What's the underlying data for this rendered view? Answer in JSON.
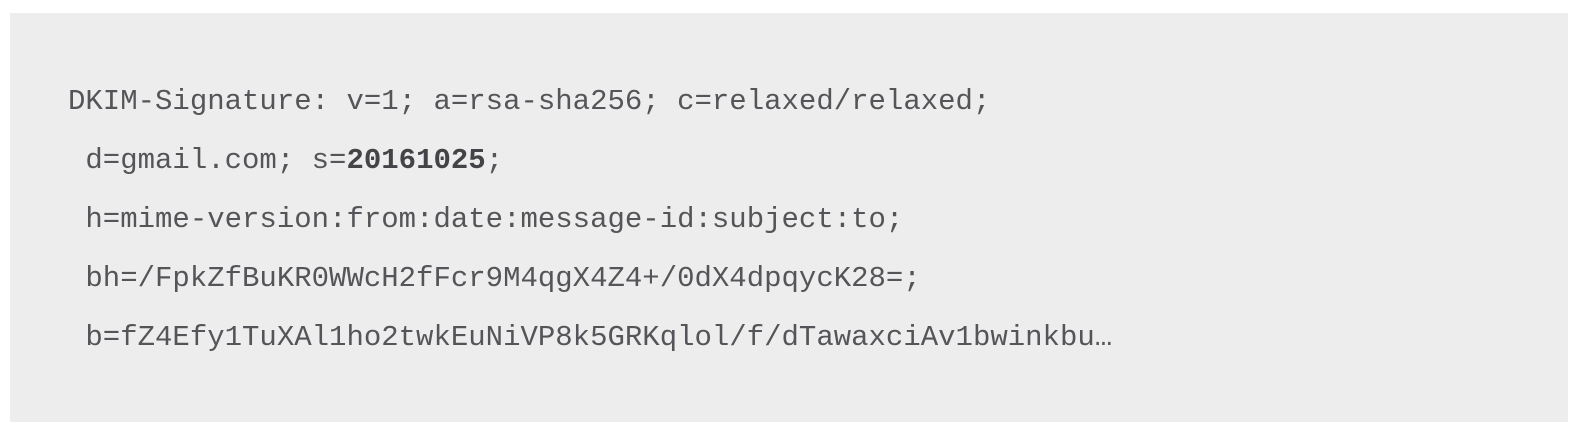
{
  "dkim": {
    "line1": "DKIM-Signature: v=1; a=rsa-sha256; c=relaxed/relaxed;",
    "line2_prefix": " d=gmail.com; s=",
    "line2_selector": "20161025",
    "line2_suffix": ";",
    "line3": " h=mime-version:from:date:message-id:subject:to;",
    "line4": " bh=/FpkZfBuKR0WWcH2fFcr9M4qgX4Z4+/0dX4dpqycK28=;",
    "line5": " b=fZ4Efy1TuXAl1ho2twkEuNiVP8k5GRKqlol/f/dTawaxciAv1bwinkbu…"
  }
}
